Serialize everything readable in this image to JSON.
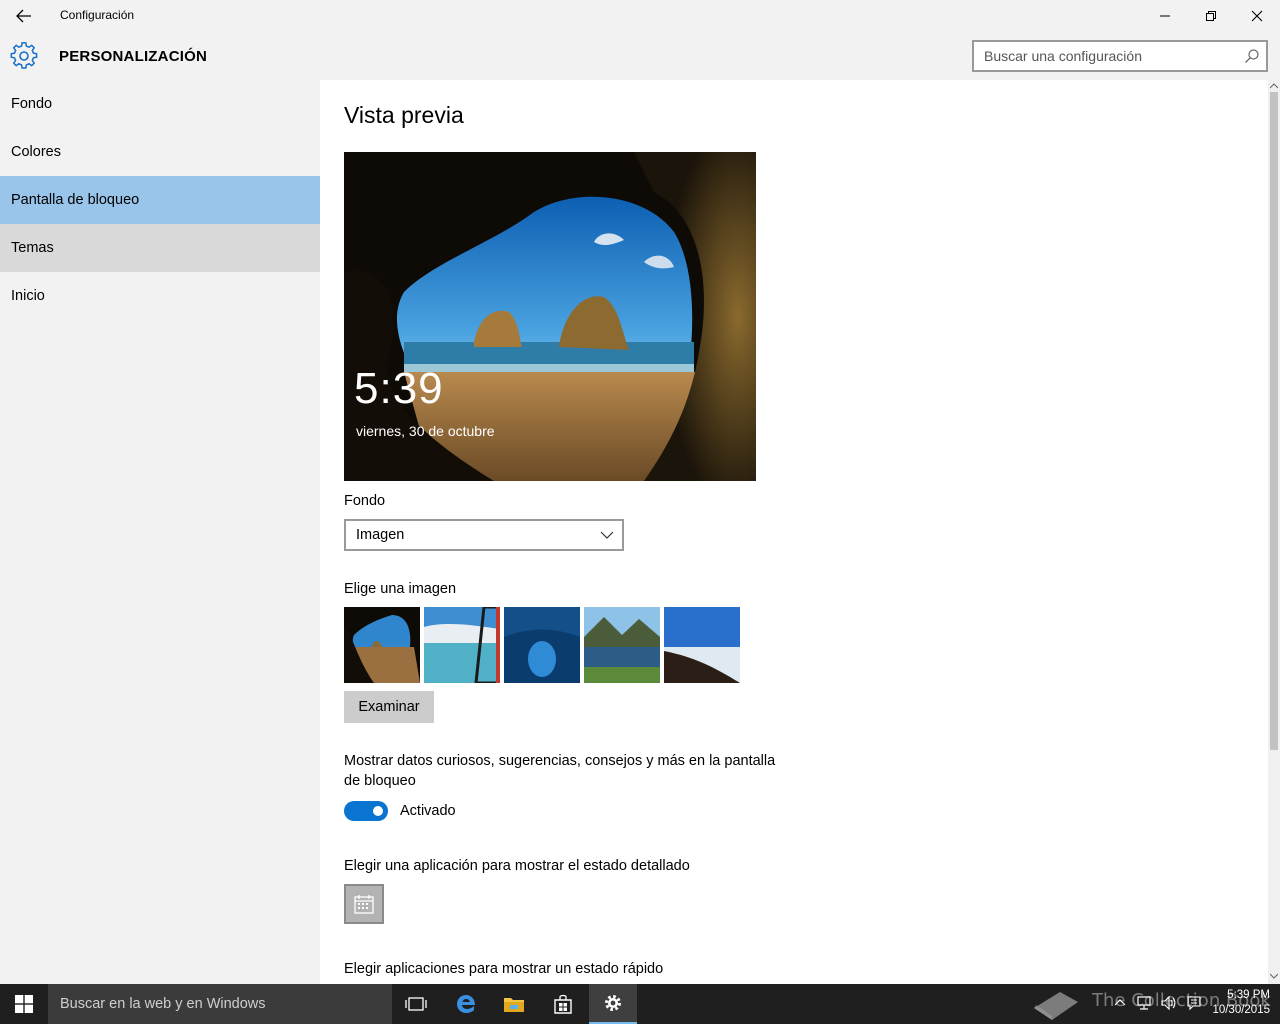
{
  "window": {
    "title": "Configuración"
  },
  "header": {
    "section_title": "PERSONALIZACIÓN",
    "search_placeholder": "Buscar una configuración"
  },
  "sidebar": {
    "items": [
      {
        "label": "Fondo",
        "state": "normal"
      },
      {
        "label": "Colores",
        "state": "normal"
      },
      {
        "label": "Pantalla de bloqueo",
        "state": "selected"
      },
      {
        "label": "Temas",
        "state": "hover"
      },
      {
        "label": "Inicio",
        "state": "normal"
      }
    ]
  },
  "main": {
    "heading": "Vista previa",
    "preview": {
      "time": "5:39",
      "date": "viernes, 30 de octubre"
    },
    "background_label": "Fondo",
    "background_value": "Imagen",
    "choose_image_label": "Elige una imagen",
    "browse_label": "Examinar",
    "tips_text": "Mostrar datos curiosos, sugerencias, consejos y más en la pantalla de bloqueo",
    "tips_toggle": {
      "on": true,
      "label": "Activado"
    },
    "detailed_status_label": "Elegir una aplicación para mostrar el estado detallado",
    "quick_status_label": "Elegir aplicaciones para mostrar un estado rápido"
  },
  "taskbar": {
    "search_text": "Buscar en la web y en Windows",
    "time": "5:39 PM",
    "date": "10/30/2015",
    "watermark": "The Collection Book"
  },
  "colors": {
    "accent": "#0a74d1",
    "selected_nav": "#99c5eb",
    "taskbar": "#1f1f1f"
  }
}
